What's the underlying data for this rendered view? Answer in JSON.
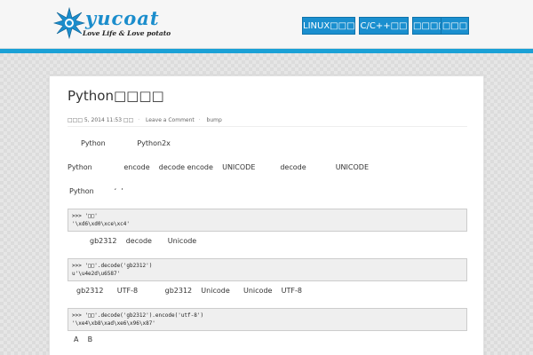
{
  "site": {
    "logo_name": "yucoat",
    "tagline": "Love Life & Love potato"
  },
  "nav": {
    "items": [
      {
        "label": "LINUX□□□"
      },
      {
        "label": "C/C++□□"
      },
      {
        "label": "□□□□"
      },
      {
        "label": "□□□"
      }
    ]
  },
  "post": {
    "title": "Python□□□□",
    "meta": {
      "date": "□□□ 5, 2014 11:53 □□",
      "comments": "Leave a Comment",
      "author": "bump"
    },
    "paragraphs": [
      "Python              Python2x",
      "Python              encode    decode encode    UNICODE           decode             UNICODE",
      "Python         ʻ  ʼ",
      "gb2312    decode       Unicode",
      "gb2312      UTF-8            gb2312    Unicode      Unicode    UTF-8",
      "A    B"
    ],
    "code_blocks": [
      {
        "lines": [
          ">>> '□□'",
          "'\\xd6\\xd0\\xce\\xc4'"
        ]
      },
      {
        "lines": [
          ">>> '□□'.decode('gb2312')",
          "u'\\u4e2d\\u6587'"
        ]
      },
      {
        "lines": [
          ">>> '□□'.decode('gb2312').encode('utf-8')",
          "'\\xe4\\xb8\\xad\\xe6\\x96\\x87'"
        ]
      }
    ]
  },
  "colors": {
    "accent": "#1ba1d6",
    "nav_bg": "#1a8fcf",
    "logo": "#1b8dcc"
  }
}
